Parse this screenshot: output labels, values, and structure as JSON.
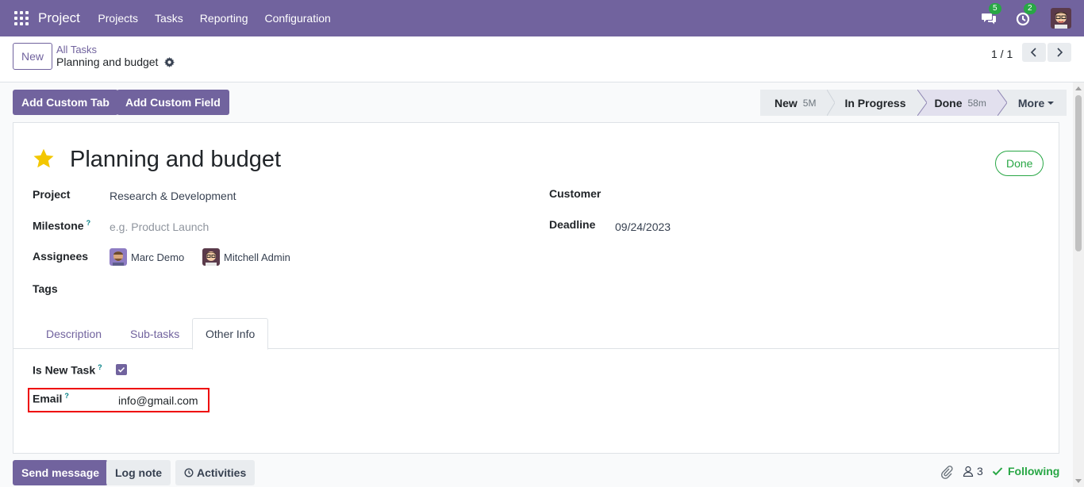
{
  "navbar": {
    "brand": "Project",
    "menu": [
      "Projects",
      "Tasks",
      "Reporting",
      "Configuration"
    ],
    "messages_count": "5",
    "activities_count": "2"
  },
  "control_panel": {
    "new_label": "New",
    "breadcrumb_parent": "All Tasks",
    "breadcrumb_current": "Planning and budget",
    "pager": "1 / 1"
  },
  "actions": {
    "add_custom_tab": "Add Custom Tab",
    "add_custom_field": "Add Custom Field"
  },
  "statusbar": {
    "stages": [
      {
        "label": "New",
        "duration": "5M"
      },
      {
        "label": "In Progress",
        "duration": ""
      },
      {
        "label": "Done",
        "duration": "58m"
      }
    ],
    "more_label": "More"
  },
  "form": {
    "title": "Planning and budget",
    "state_badge": "Done",
    "project_label": "Project",
    "project_value": "Research & Development",
    "milestone_label": "Milestone",
    "milestone_help": "?",
    "milestone_placeholder": "e.g. Product Launch",
    "assignees_label": "Assignees",
    "assignees": [
      "Marc Demo",
      "Mitchell Admin"
    ],
    "tags_label": "Tags",
    "customer_label": "Customer",
    "deadline_label": "Deadline",
    "deadline_value": "09/24/2023"
  },
  "tabs": [
    "Description",
    "Sub-tasks",
    "Other Info"
  ],
  "other_info": {
    "is_new_task_label": "Is New Task",
    "is_new_task_help": "?",
    "is_new_task_checked": true,
    "email_label": "Email",
    "email_help": "?",
    "email_value": "info@gmail.com"
  },
  "chatter": {
    "send_message": "Send message",
    "log_note": "Log note",
    "activities": "Activities",
    "followers_count": "3",
    "following_label": "Following"
  },
  "colors": {
    "brand": "#71639e",
    "success": "#28a745",
    "highlight_border": "#ee0000"
  }
}
